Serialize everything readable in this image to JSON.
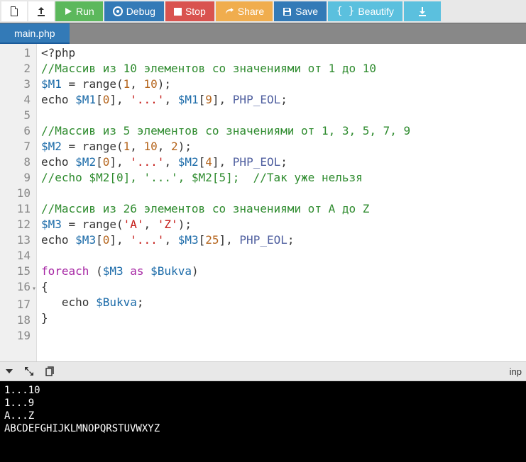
{
  "toolbar": {
    "run": "Run",
    "debug": "Debug",
    "stop": "Stop",
    "share": "Share",
    "save": "Save",
    "beautify": "Beautify"
  },
  "tab": {
    "name": "main.php"
  },
  "code": {
    "lines": [
      {
        "n": 1,
        "tokens": [
          {
            "t": "plain",
            "v": "<?php"
          }
        ]
      },
      {
        "n": 2,
        "tokens": [
          {
            "t": "comment",
            "v": "//Массив из 10 элементов со значениями от 1 до 10"
          }
        ]
      },
      {
        "n": 3,
        "tokens": [
          {
            "t": "var",
            "v": "$M1"
          },
          {
            "t": "plain",
            "v": " = range("
          },
          {
            "t": "num",
            "v": "1"
          },
          {
            "t": "plain",
            "v": ", "
          },
          {
            "t": "num",
            "v": "10"
          },
          {
            "t": "plain",
            "v": ");"
          }
        ]
      },
      {
        "n": 4,
        "tokens": [
          {
            "t": "plain",
            "v": "echo "
          },
          {
            "t": "var",
            "v": "$M1"
          },
          {
            "t": "plain",
            "v": "["
          },
          {
            "t": "num",
            "v": "0"
          },
          {
            "t": "plain",
            "v": "], "
          },
          {
            "t": "str",
            "v": "'...'"
          },
          {
            "t": "plain",
            "v": ", "
          },
          {
            "t": "var",
            "v": "$M1"
          },
          {
            "t": "plain",
            "v": "["
          },
          {
            "t": "num",
            "v": "9"
          },
          {
            "t": "plain",
            "v": "], "
          },
          {
            "t": "const",
            "v": "PHP_EOL"
          },
          {
            "t": "plain",
            "v": ";"
          }
        ]
      },
      {
        "n": 5,
        "tokens": []
      },
      {
        "n": 6,
        "tokens": [
          {
            "t": "comment",
            "v": "//Массив из 5 элементов со значениями от 1, 3, 5, 7, 9"
          }
        ]
      },
      {
        "n": 7,
        "tokens": [
          {
            "t": "var",
            "v": "$M2"
          },
          {
            "t": "plain",
            "v": " = range("
          },
          {
            "t": "num",
            "v": "1"
          },
          {
            "t": "plain",
            "v": ", "
          },
          {
            "t": "num",
            "v": "10"
          },
          {
            "t": "plain",
            "v": ", "
          },
          {
            "t": "num",
            "v": "2"
          },
          {
            "t": "plain",
            "v": ");"
          }
        ]
      },
      {
        "n": 8,
        "tokens": [
          {
            "t": "plain",
            "v": "echo "
          },
          {
            "t": "var",
            "v": "$M2"
          },
          {
            "t": "plain",
            "v": "["
          },
          {
            "t": "num",
            "v": "0"
          },
          {
            "t": "plain",
            "v": "], "
          },
          {
            "t": "str",
            "v": "'...'"
          },
          {
            "t": "plain",
            "v": ", "
          },
          {
            "t": "var",
            "v": "$M2"
          },
          {
            "t": "plain",
            "v": "["
          },
          {
            "t": "num",
            "v": "4"
          },
          {
            "t": "plain",
            "v": "], "
          },
          {
            "t": "const",
            "v": "PHP_EOL"
          },
          {
            "t": "plain",
            "v": ";"
          }
        ]
      },
      {
        "n": 9,
        "tokens": [
          {
            "t": "comment",
            "v": "//echo $M2[0], '...', $M2[5];  //Так уже нельзя"
          }
        ]
      },
      {
        "n": 10,
        "tokens": []
      },
      {
        "n": 11,
        "tokens": [
          {
            "t": "comment",
            "v": "//Массив из 26 элементов со значениями от A до Z"
          }
        ]
      },
      {
        "n": 12,
        "tokens": [
          {
            "t": "var",
            "v": "$M3"
          },
          {
            "t": "plain",
            "v": " = range("
          },
          {
            "t": "str",
            "v": "'A'"
          },
          {
            "t": "plain",
            "v": ", "
          },
          {
            "t": "str",
            "v": "'Z'"
          },
          {
            "t": "plain",
            "v": ");"
          }
        ]
      },
      {
        "n": 13,
        "tokens": [
          {
            "t": "plain",
            "v": "echo "
          },
          {
            "t": "var",
            "v": "$M3"
          },
          {
            "t": "plain",
            "v": "["
          },
          {
            "t": "num",
            "v": "0"
          },
          {
            "t": "plain",
            "v": "], "
          },
          {
            "t": "str",
            "v": "'...'"
          },
          {
            "t": "plain",
            "v": ", "
          },
          {
            "t": "var",
            "v": "$M3"
          },
          {
            "t": "plain",
            "v": "["
          },
          {
            "t": "num",
            "v": "25"
          },
          {
            "t": "plain",
            "v": "], "
          },
          {
            "t": "const",
            "v": "PHP_EOL"
          },
          {
            "t": "plain",
            "v": ";"
          }
        ]
      },
      {
        "n": 14,
        "tokens": []
      },
      {
        "n": 15,
        "tokens": [
          {
            "t": "kw",
            "v": "foreach"
          },
          {
            "t": "plain",
            "v": " ("
          },
          {
            "t": "var",
            "v": "$M3"
          },
          {
            "t": "plain",
            "v": " "
          },
          {
            "t": "kw",
            "v": "as"
          },
          {
            "t": "plain",
            "v": " "
          },
          {
            "t": "var",
            "v": "$Bukva"
          },
          {
            "t": "plain",
            "v": ")"
          }
        ]
      },
      {
        "n": 16,
        "fold": true,
        "tokens": [
          {
            "t": "plain",
            "v": "{"
          }
        ]
      },
      {
        "n": 17,
        "tokens": [
          {
            "t": "plain",
            "v": "   echo "
          },
          {
            "t": "var",
            "v": "$Bukva"
          },
          {
            "t": "plain",
            "v": ";"
          }
        ]
      },
      {
        "n": 18,
        "tokens": [
          {
            "t": "plain",
            "v": "}"
          }
        ]
      },
      {
        "n": 19,
        "tokens": []
      }
    ]
  },
  "consoleBar": {
    "right": "inp"
  },
  "output": {
    "lines": [
      "1...10",
      "1...9",
      "A...Z",
      "ABCDEFGHIJKLMNOPQRSTUVWXYZ"
    ]
  }
}
